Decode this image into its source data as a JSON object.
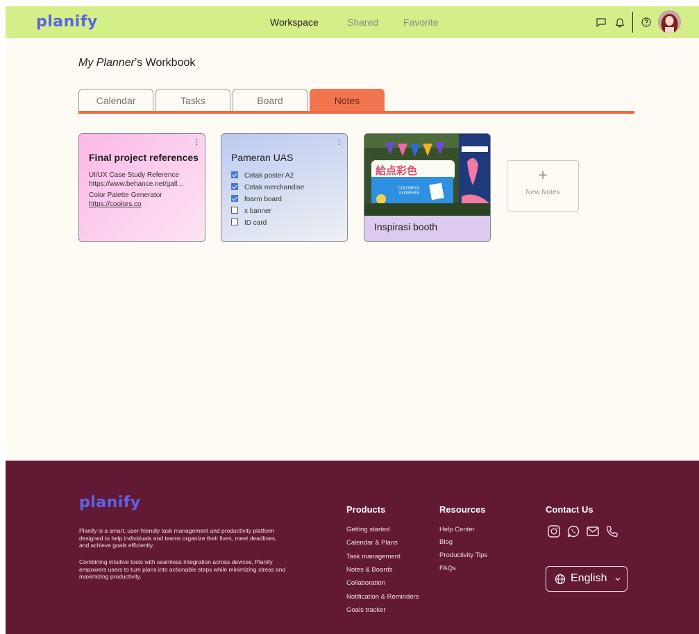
{
  "header": {
    "logo": "planify",
    "nav": [
      "Workspace",
      "Shared",
      "Favorite"
    ],
    "active_nav": "Workspace",
    "icons": [
      "chat-icon",
      "bell-icon",
      "help-icon"
    ]
  },
  "workbook": {
    "title_italic": "My Planner",
    "title_rest": "’s Workbook",
    "tabs": [
      "Calendar",
      "Tasks",
      "Board",
      "Notes"
    ],
    "active_tab": "Notes"
  },
  "notes": {
    "card1": {
      "title": "Final project references",
      "lines": [
        "UI/UX Case Study Reference",
        "https://www.behance.net/gall...",
        "Color Palette Generator",
        "https://coolors.co"
      ]
    },
    "card2": {
      "title": "Pameran UAS",
      "items": [
        {
          "label": "Cetak poster A2",
          "checked": true
        },
        {
          "label": "Cetak merchandise",
          "checked": true
        },
        {
          "label": "foarm board",
          "checked": true
        },
        {
          "label": "x banner",
          "checked": false
        },
        {
          "label": "ID card",
          "checked": false
        }
      ]
    },
    "card3": {
      "title": "Inspirasi booth",
      "image_text": "COLORFUL FLOWERS"
    },
    "new_note": {
      "icon": "+",
      "label": "New Notes"
    }
  },
  "footer": {
    "logo": "planify",
    "description_1": "Planify is a smart, user-friendly task management and productivity platform designed to help individuals and teams organize their lives, meet deadlines, and achieve goals efficiently.",
    "description_2": "Combining intuitive tools with seamless integration across devices, Planify empowers users to turn plans into actionable steps while minimizing stress and maximizing productivity.",
    "products": {
      "heading": "Products",
      "links": [
        "Getting started",
        "Calendar & Plans",
        "Task management",
        "Notes & Boards",
        "Collaboration",
        "Notification & Reminders",
        "Goals tracker"
      ]
    },
    "resources": {
      "heading": "Resources",
      "links": [
        "Help Center",
        "Blog",
        "Productivity Tips",
        "FAQs"
      ]
    },
    "contact": {
      "heading": "Contact Us",
      "icons": [
        "instagram-icon",
        "whatsapp-icon",
        "mail-icon",
        "phone-icon"
      ]
    },
    "language": "English"
  },
  "colors": {
    "header_bg": "#d4ee88",
    "brand": "#5b64e6",
    "accent": "#f07550",
    "footer_bg": "#621933",
    "page_bg": "#fdfbf3"
  }
}
